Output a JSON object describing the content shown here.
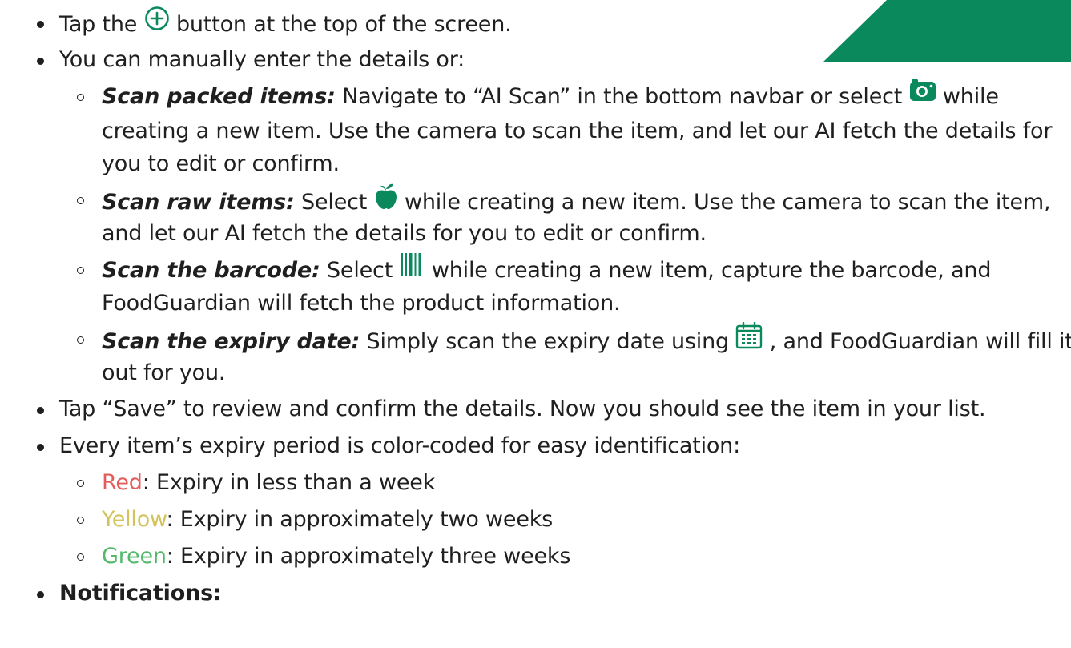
{
  "colors": {
    "accent": "#0a8a5c",
    "red": "#e35d5d",
    "yellow": "#d4c35a",
    "green": "#52b86a"
  },
  "icons": {
    "add": "plus-circle-icon",
    "camera": "camera-icon",
    "apple": "apple-icon",
    "barcode": "barcode-icon",
    "calendar": "calendar-icon"
  },
  "steps": {
    "tap_add_pre": "Tap the",
    "tap_add_post": "button at the top of the screen.",
    "manual": "You can manually enter the details or:",
    "packed_label": "Scan packed items:",
    "packed_text_1": "Navigate to “AI Scan” in the bottom navbar or select",
    "packed_text_1b": "while",
    "packed_text_2": "creating a new item. Use the camera to scan the item, and let our AI fetch the details for",
    "packed_text_3": "you to edit or confirm.",
    "raw_label": "Scan raw items:",
    "raw_text_1": "Select",
    "raw_text_1b": "while creating a new item. Use the camera to scan the item,",
    "raw_text_2": "and let our AI fetch the details for you to edit or confirm.",
    "barcode_label": "Scan the barcode:",
    "barcode_text_1": "Select",
    "barcode_text_1b": "while creating a new item, capture the barcode, and",
    "barcode_text_2": "FoodGuardian will fetch the product information.",
    "expiry_label": "Scan the expiry date:",
    "expiry_text_1": "Simply scan the expiry date using",
    "expiry_text_1b": ", and FoodGuardian will fill it",
    "expiry_text_2": "out for you.",
    "save": "Tap “Save” to review and confirm the details. Now you should see the item in your list.",
    "color_coded": "Every item’s expiry period is color-coded for easy identification:",
    "red_word": "Red",
    "red_text": ": Expiry in less than a week",
    "yellow_word": "Yellow",
    "yellow_text": ": Expiry in approximately two weeks",
    "green_word": "Green",
    "green_text": ": Expiry in approximately three weeks",
    "notifications": "Notifications:"
  }
}
